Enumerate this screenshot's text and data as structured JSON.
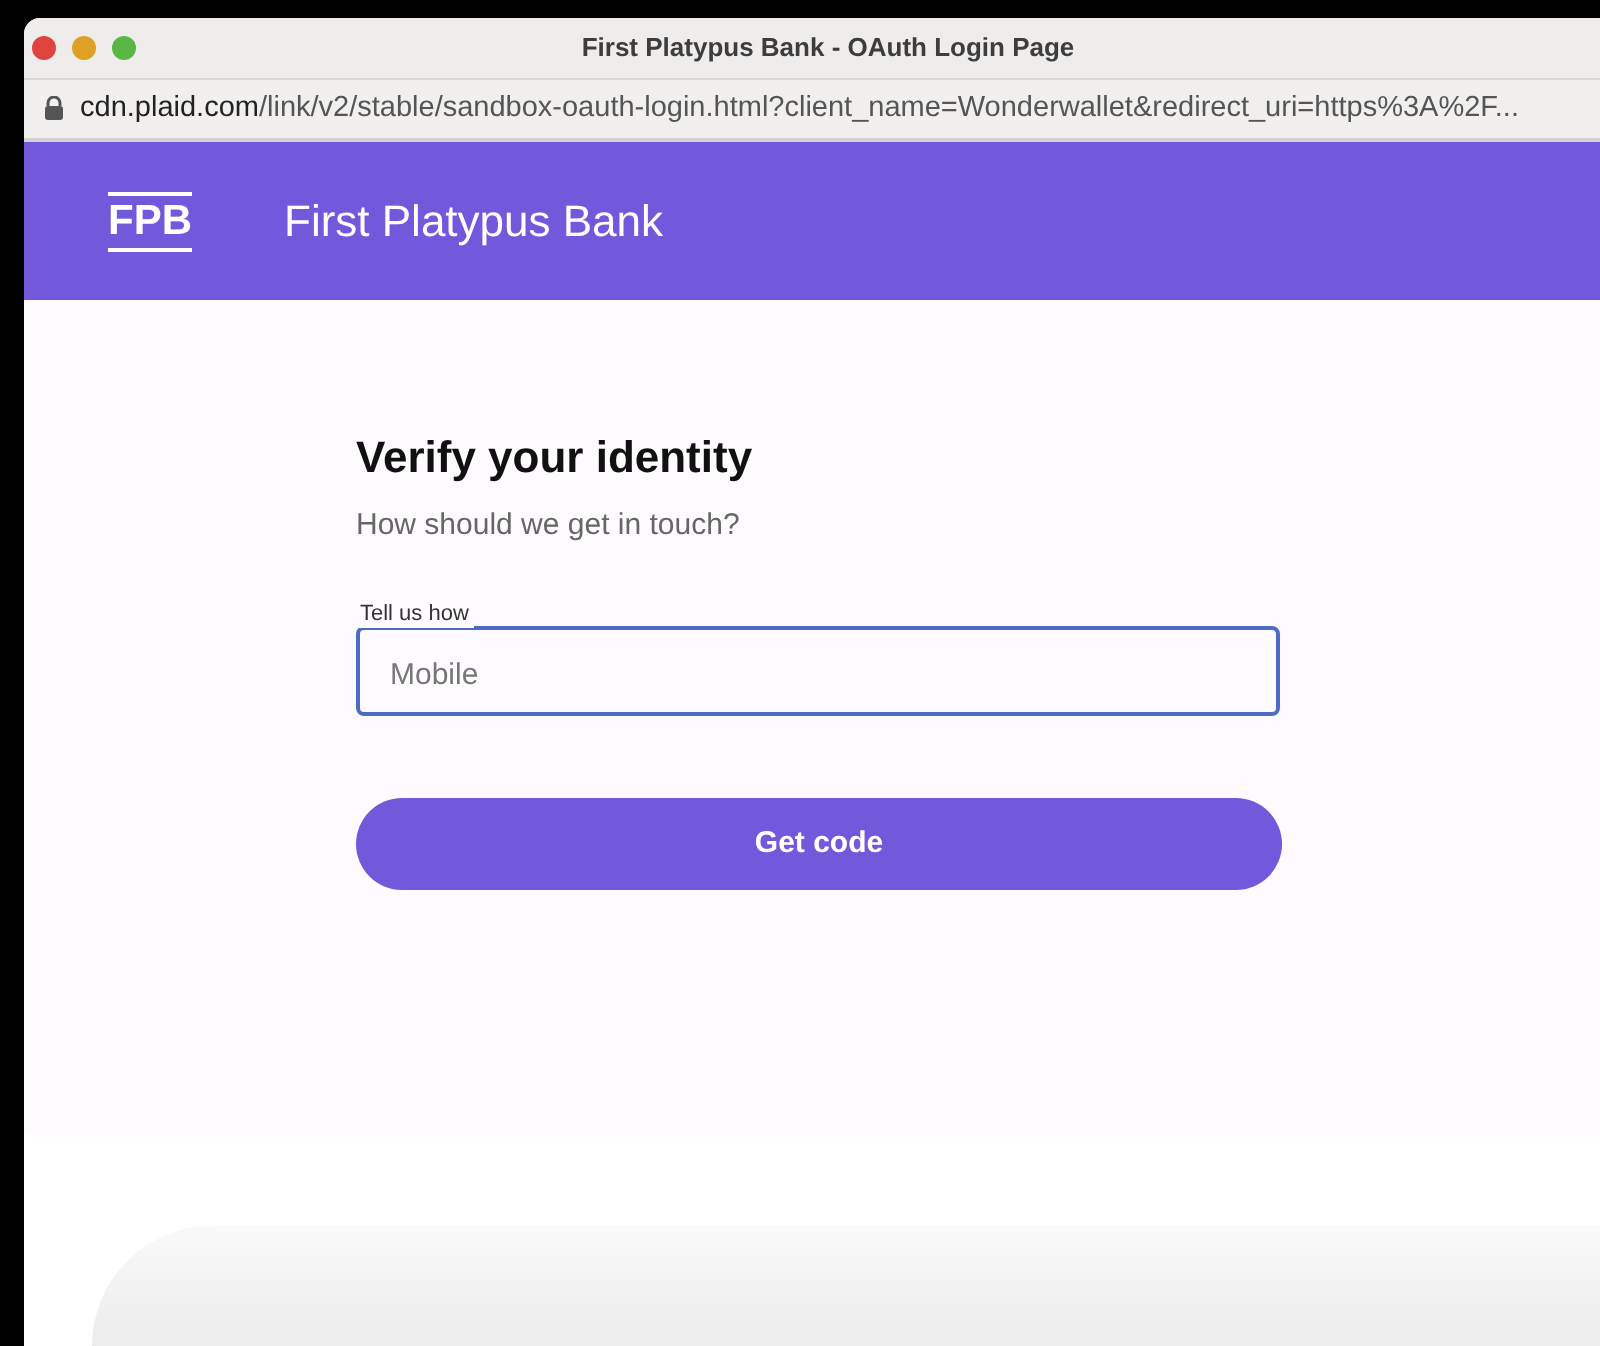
{
  "window": {
    "title": "First Platypus Bank - OAuth Login Page"
  },
  "address_bar": {
    "domain": "cdn.plaid.com",
    "path": "/link/v2/stable/sandbox-oauth-login.html?client_name=Wonderwallet&redirect_uri=https%3A%2F..."
  },
  "header": {
    "logo": "FPB",
    "bank_name": "First Platypus Bank"
  },
  "form": {
    "title": "Verify your identity",
    "subtitle": "How should we get in touch?",
    "field": {
      "label": "Tell us how",
      "value": "Mobile"
    },
    "button": "Get code"
  }
}
